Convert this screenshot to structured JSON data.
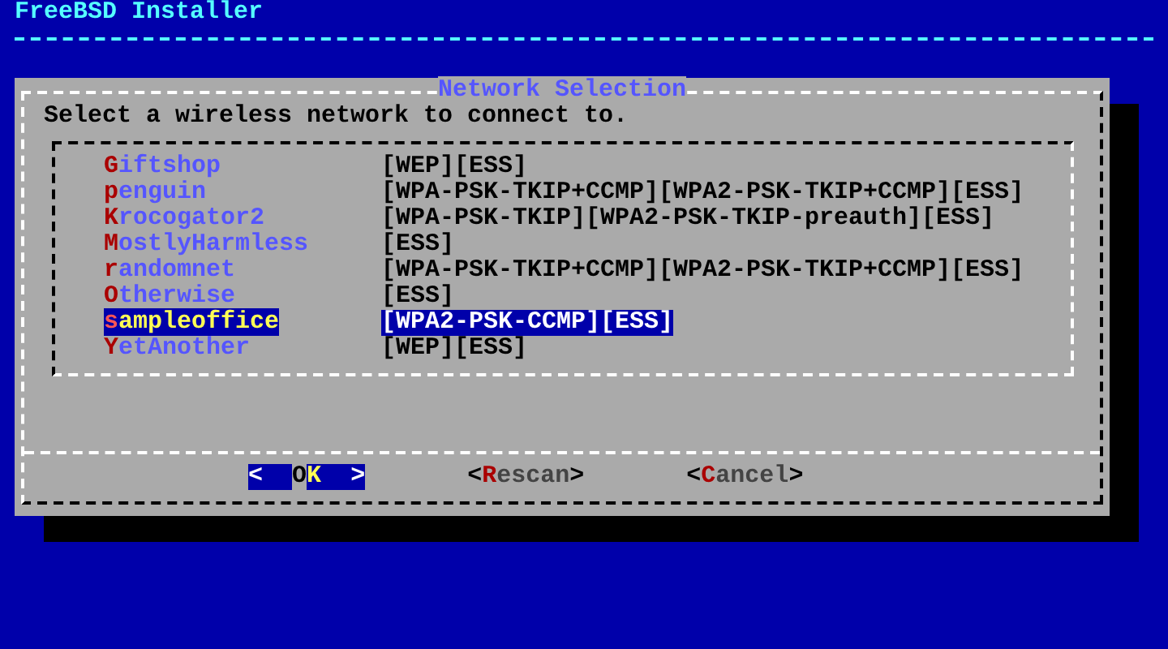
{
  "header": {
    "title": "FreeBSD Installer"
  },
  "dialog": {
    "title": "Network Selection",
    "prompt": "Select a wireless network to connect to.",
    "networks": [
      {
        "name": "Giftshop",
        "security": "[WEP][ESS]",
        "selected": false
      },
      {
        "name": "penguin",
        "security": "[WPA-PSK-TKIP+CCMP][WPA2-PSK-TKIP+CCMP][ESS]",
        "selected": false
      },
      {
        "name": "Krocogator2",
        "security": "[WPA-PSK-TKIP][WPA2-PSK-TKIP-preauth][ESS]",
        "selected": false
      },
      {
        "name": "MostlyHarmless",
        "security": "[ESS]",
        "selected": false
      },
      {
        "name": "randomnet",
        "security": "[WPA-PSK-TKIP+CCMP][WPA2-PSK-TKIP+CCMP][ESS]",
        "selected": false
      },
      {
        "name": "Otherwise",
        "security": "[ESS]",
        "selected": false
      },
      {
        "name": "sampleoffice",
        "security": "[WPA2-PSK-CCMP][ESS]",
        "selected": true
      },
      {
        "name": "YetAnother",
        "security": "[WEP][ESS]",
        "selected": false
      }
    ],
    "buttons": [
      {
        "label": "<  OK  >",
        "selected": true
      },
      {
        "label": "<Rescan>",
        "selected": false
      },
      {
        "label": "<Cancel>",
        "selected": false
      }
    ]
  }
}
